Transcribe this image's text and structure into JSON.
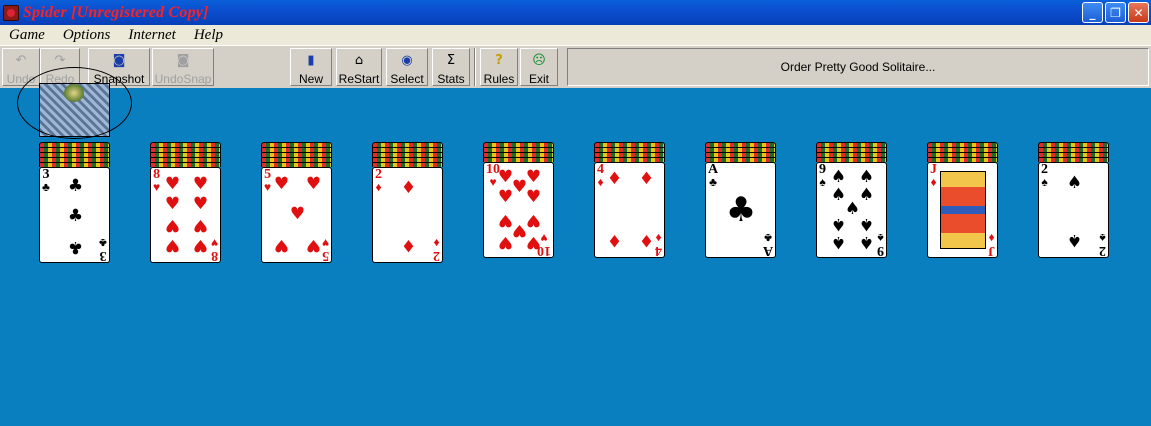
{
  "window": {
    "title": "Spider [Unregistered Copy]"
  },
  "menu": [
    "Game",
    "Options",
    "Internet",
    "Help"
  ],
  "toolbar": {
    "undo": "Undo",
    "redo": "Redo",
    "snapshot": "Snapshot",
    "undosnap": "UndoSnap",
    "new": "New",
    "restart": "ReStart",
    "select": "Select",
    "stats": "Stats",
    "rules": "Rules",
    "exit": "Exit",
    "order": "Order Pretty Good Solitaire..."
  },
  "colors": {
    "table": "#0a7fbf",
    "red_suit": "#e01010",
    "black_suit": "#000000"
  },
  "tableau": [
    {
      "rank": "3",
      "suit": "♣",
      "color": "black",
      "backs": 5
    },
    {
      "rank": "8",
      "suit": "♥",
      "color": "red",
      "backs": 5
    },
    {
      "rank": "5",
      "suit": "♥",
      "color": "red",
      "backs": 5
    },
    {
      "rank": "2",
      "suit": "♦",
      "color": "red",
      "backs": 5
    },
    {
      "rank": "10",
      "suit": "♥",
      "color": "red",
      "backs": 4
    },
    {
      "rank": "4",
      "suit": "♦",
      "color": "red",
      "backs": 4
    },
    {
      "rank": "A",
      "suit": "♣",
      "color": "black",
      "backs": 4
    },
    {
      "rank": "9",
      "suit": "♠",
      "color": "black",
      "backs": 4
    },
    {
      "rank": "J",
      "suit": "♦",
      "color": "red",
      "backs": 4
    },
    {
      "rank": "2",
      "suit": "♠",
      "color": "black",
      "backs": 4
    }
  ]
}
